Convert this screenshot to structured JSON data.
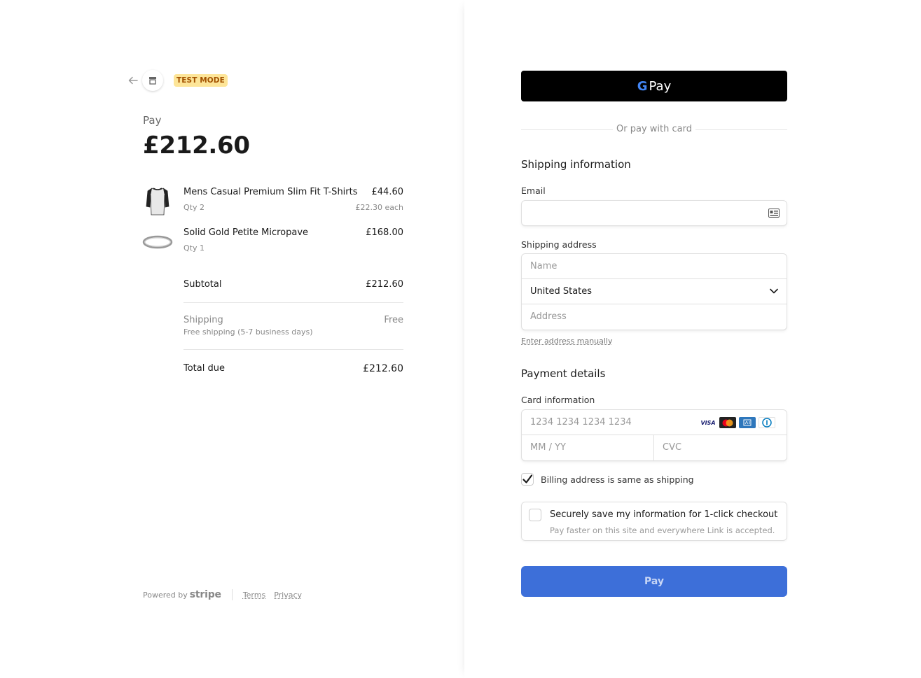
{
  "header": {
    "test_badge": "TEST MODE"
  },
  "summary": {
    "pay_label": "Pay",
    "amount": "£212.60"
  },
  "items": [
    {
      "name": "Mens Casual Premium Slim Fit T-Shirts",
      "qty": "Qty 2",
      "price": "£44.60",
      "each": "£22.30 each",
      "icon": "tshirt-icon"
    },
    {
      "name": "Solid Gold Petite Micropave",
      "qty": "Qty 1",
      "price": "£168.00",
      "each": "",
      "icon": "ring-icon"
    }
  ],
  "totals": {
    "subtotal_label": "Subtotal",
    "subtotal_value": "£212.60",
    "shipping_label": "Shipping",
    "shipping_sub": "Free shipping (5-7 business days)",
    "shipping_value": "Free",
    "total_label": "Total due",
    "total_value": "£212.60"
  },
  "footer": {
    "powered_by": "Powered by",
    "stripe": "stripe",
    "terms": "Terms",
    "privacy": "Privacy"
  },
  "payment": {
    "gpay_g": "G",
    "gpay_label": "Pay",
    "or_text": "Or pay with card",
    "shipping_title": "Shipping information",
    "email_label": "Email",
    "email_value": "",
    "address_label": "Shipping address",
    "name_placeholder": "Name",
    "country": "United States",
    "address_placeholder": "Address",
    "enter_manually": "Enter address manually",
    "payment_title": "Payment details",
    "card_label": "Card information",
    "card_placeholder": "1234 1234 1234 1234",
    "expiry_placeholder": "MM / YY",
    "cvc_placeholder": "CVC",
    "card_brands": [
      "VISA",
      "mastercard",
      "amex",
      "diners"
    ],
    "billing_same": "Billing address is same as shipping",
    "billing_checked": true,
    "save_title": "Securely save my information for 1-click checkout",
    "save_sub": "Pay faster on this site and everywhere Link is accepted.",
    "save_checked": false,
    "pay_button": "Pay"
  },
  "colors": {
    "pay_button": "#3d6fd9",
    "badge_bg": "#fde598",
    "badge_text": "#a35200"
  }
}
